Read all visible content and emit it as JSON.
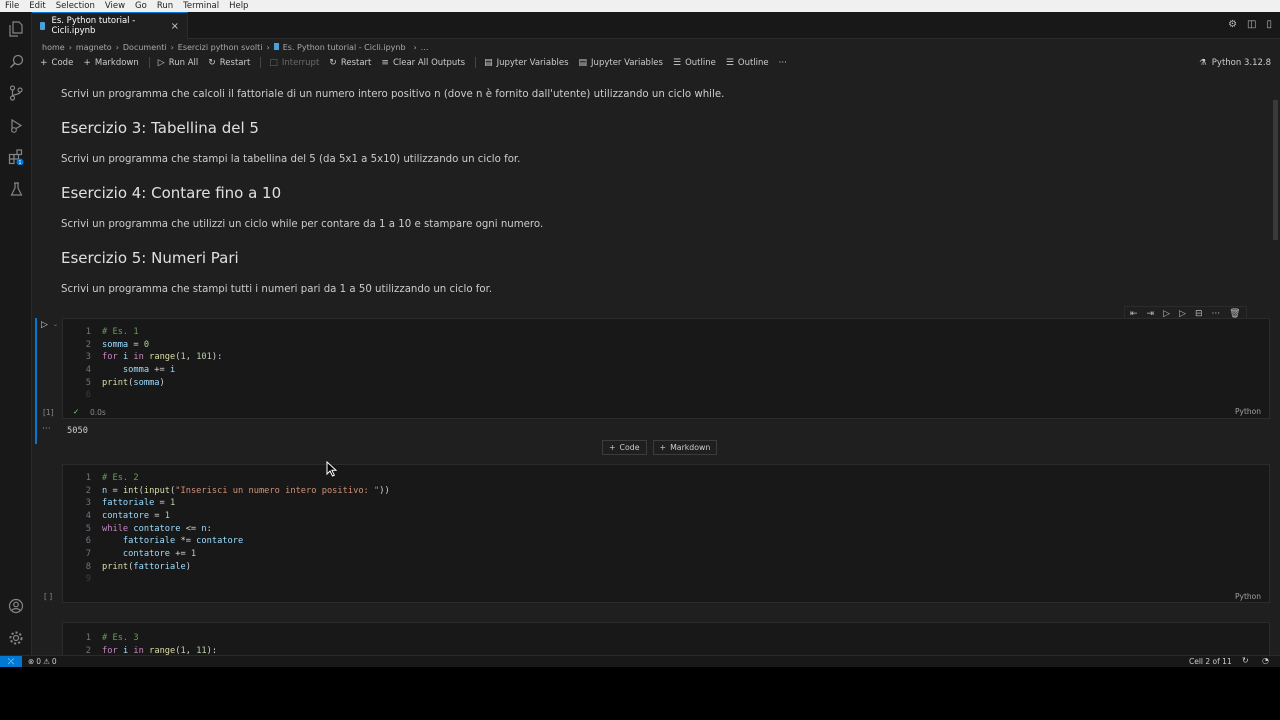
{
  "menubar": [
    "File",
    "Edit",
    "Selection",
    "View",
    "Go",
    "Run",
    "Terminal",
    "Help"
  ],
  "tab": {
    "title": "Es. Python tutorial - Cicli.ipynb",
    "close": "×"
  },
  "breadcrumb": [
    "home",
    "›",
    "magneto",
    "›",
    "Documenti",
    "›",
    "Esercizi python svolti",
    "›",
    "Es. Python tutorial - Cicli.ipynb",
    "›",
    "..."
  ],
  "toolbar": {
    "code": "Code",
    "markdown": "Markdown",
    "run_all": "Run All",
    "restart": "Restart",
    "interrupt": "Interrupt",
    "restart2": "Restart",
    "clear": "Clear All Outputs",
    "jupyter1": "Jupyter Variables",
    "jupyter2": "Jupyter Variables",
    "outline1": "Outline",
    "outline2": "Outline",
    "more": "···",
    "kernel": "Python 3.12.8"
  },
  "markdown": {
    "p1": "Scrivi un programma che calcoli il fattoriale di un numero intero positivo n (dove n è fornito dall'utente) utilizzando un ciclo while.",
    "h3": "Esercizio 3: Tabellina del 5",
    "p3": "Scrivi un programma che stampi la tabellina del 5 (da 5x1 a 5x10) utilizzando un ciclo for.",
    "h4": "Esercizio 4: Contare fino a 10",
    "p4": "Scrivi un programma che utilizzi un ciclo while per contare da 1 a 10 e stampare ogni numero.",
    "h5": "Esercizio 5: Numeri Pari",
    "p5": "Scrivi un programma che stampi tutti i numeri pari da 1 a 50 utilizzando un ciclo for."
  },
  "cell1": {
    "exec": "[1]",
    "time": "0.0s",
    "lang": "Python",
    "output": "5050"
  },
  "cell2": {
    "exec": "[ ]",
    "lang": "Python"
  },
  "add": {
    "code": "Code",
    "markdown": "Markdown"
  },
  "status": {
    "errors": "0",
    "warnings": "0",
    "cell": "Cell 2 of 11"
  },
  "colors": {
    "accent": "#0078d4",
    "editor_bg": "#1f1f1f",
    "cell_bg": "#181818"
  }
}
